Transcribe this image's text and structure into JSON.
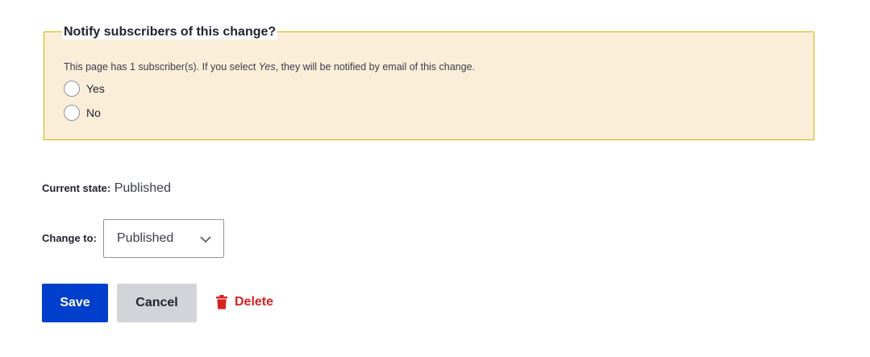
{
  "notify": {
    "legend": "Notify subscribers of this change?",
    "description_before": "This page has 1 subscriber(s). If you select ",
    "description_em": "Yes",
    "description_after": ", they will be notified by email of this change.",
    "options": [
      {
        "label": "Yes",
        "checked": false
      },
      {
        "label": "No",
        "checked": false
      }
    ]
  },
  "state": {
    "current_label": "Current state:",
    "current_value": "Published",
    "change_label": "Change to:",
    "change_value": "Published"
  },
  "actions": {
    "save_label": "Save",
    "cancel_label": "Cancel",
    "delete_label": "Delete",
    "delete_icon": "trash-icon"
  },
  "colors": {
    "fieldset_bg": "#fbeed9",
    "fieldset_border": "#d8b300",
    "primary": "#003ecc",
    "danger": "#d72222"
  }
}
